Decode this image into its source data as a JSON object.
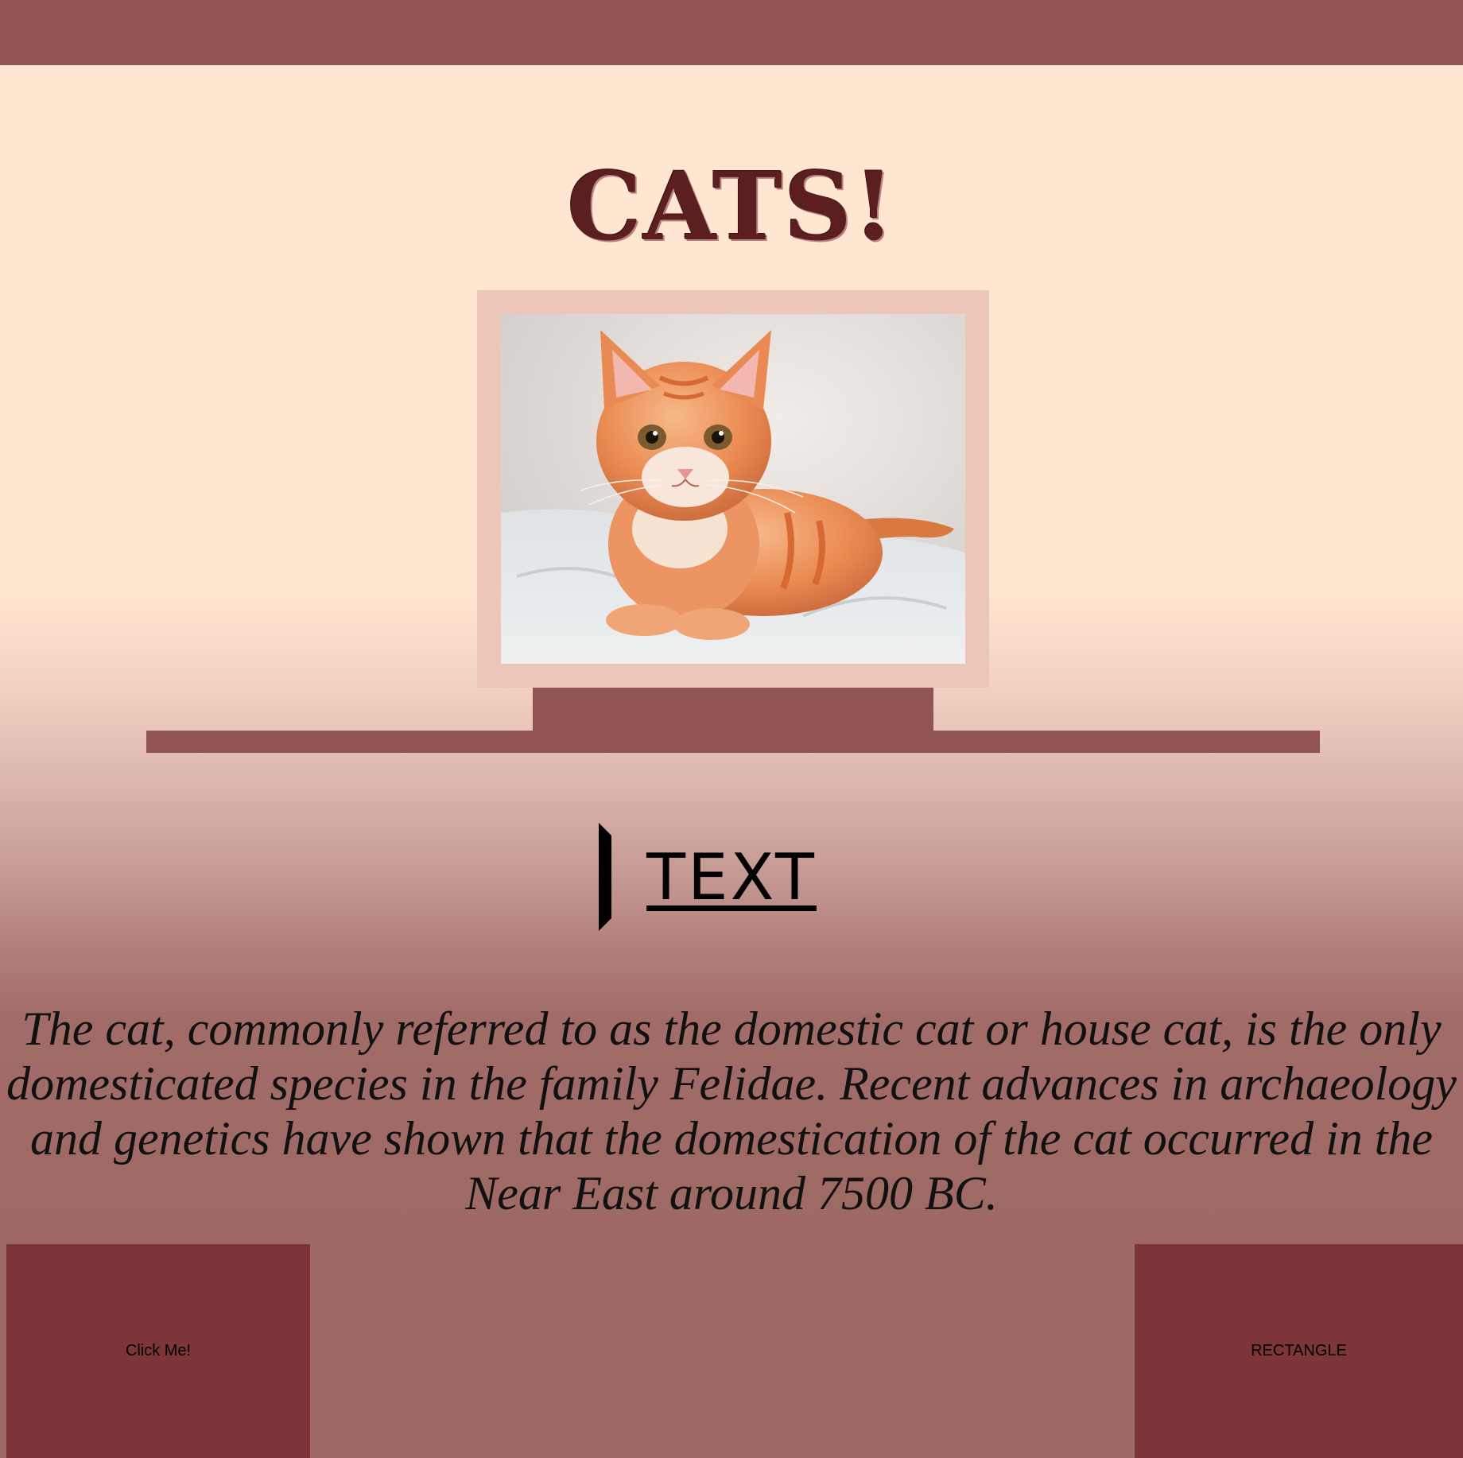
{
  "header": {
    "title": "CATS!"
  },
  "photo": {
    "subject": "orange-tabby-kitten"
  },
  "section": {
    "heading_link": "TEXT",
    "description": "The cat, commonly referred to as the domestic cat or house cat, is the only domesticated species in the family Felidae. Recent advances in archaeology and genetics have shown that the domestication of the cat occurred in the Near East around 7500 BC."
  },
  "buttons": {
    "click_label": "Click Me!",
    "rectangle_label": "RECTANGLE"
  },
  "colors": {
    "bar": "#925452",
    "button": "#7d353a",
    "title": "#5c1f1f",
    "frame": "#ebc6b9",
    "background_top": "#ffe6d0",
    "background_bottom": "#9e6963"
  }
}
